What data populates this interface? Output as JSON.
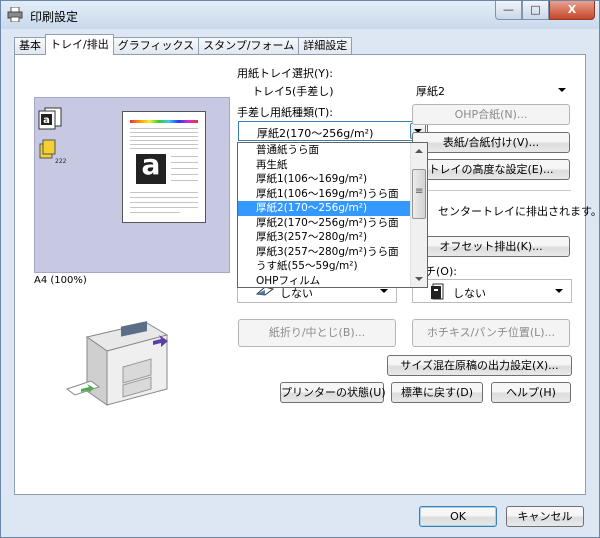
{
  "window": {
    "title": "印刷設定",
    "minimize": "—",
    "maximize": "□",
    "close": "X"
  },
  "tabs": [
    "基本",
    "トレイ/排出",
    "グラフィックス",
    "スタンプ/フォーム",
    "詳細設定"
  ],
  "active_tab": 1,
  "preview": {
    "paper_size": "A4 (100%)",
    "sample_glyph": "a"
  },
  "paper_tray": {
    "label": "用紙トレイ選択(Y):",
    "value": "トレイ5(手差し)",
    "paper": "厚紙2"
  },
  "bypass_type": {
    "label": "手差し用紙種類(T):",
    "value": "厚紙2(170～256g/m²)",
    "options": [
      "普通紙うら面",
      "再生紙",
      "厚紙1(106～169g/m²)",
      "厚紙1(106～169g/m²)うら面",
      "厚紙2(170～256g/m²)",
      "厚紙2(170～256g/m²)うら面",
      "厚紙3(257～280g/m²)",
      "厚紙3(257～280g/m²)うら面",
      "うす紙(55～59g/m²)",
      "OHPフィルム"
    ],
    "selected_index": 4
  },
  "buttons": {
    "ohp": "OHP合紙(N)...",
    "cover": "表紙/合紙付け(V)...",
    "tray_advanced": "トレイの高度な設定(E)...",
    "offset": "オフセット排出(K)...",
    "fold": "紙折り/中とじ(B)...",
    "staple": "ホチキス/パンチ位置(L)...",
    "mixed_size": "サイズ混在原稿の出力設定(X)...",
    "printer_status": "プリンターの状態(U)",
    "restore_default": "標準に戻す(D)",
    "help": "ヘルプ(H)",
    "ok": "OK",
    "cancel": "キャンセル"
  },
  "output": {
    "text": "センタートレイに排出されます。",
    "staple_label_tail": "チ(O):"
  },
  "fold_combo": {
    "value": "しない"
  },
  "staple_combo": {
    "value": "しない"
  },
  "colors": {
    "selection": "#3399ff",
    "window_bg": "#dde7f3",
    "preview_bg": "#c7c9e3"
  }
}
